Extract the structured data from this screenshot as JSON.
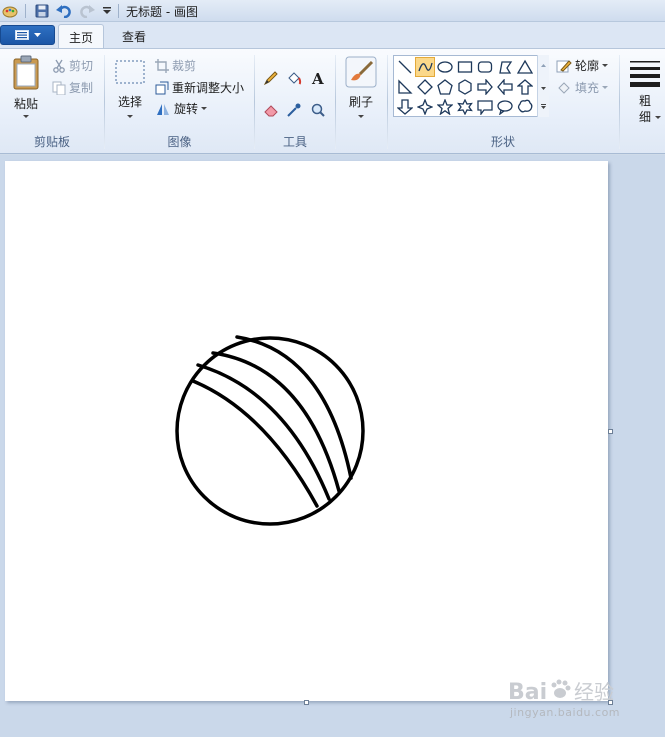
{
  "window": {
    "title": "无标题 - 画图"
  },
  "quick_access": {
    "icons": [
      "paint-app-icon",
      "save-icon",
      "undo-icon",
      "redo-icon",
      "customize-dropdown-icon"
    ]
  },
  "tabs": [
    {
      "label": "主页",
      "active": true
    },
    {
      "label": "查看",
      "active": false
    }
  ],
  "ribbon": {
    "clipboard": {
      "paste": "粘贴",
      "cut": "剪切",
      "copy": "复制",
      "group": "剪贴板"
    },
    "image": {
      "select": "选择",
      "crop": "裁剪",
      "resize": "重新调整大小",
      "rotate": "旋转",
      "group": "图像"
    },
    "tools": {
      "group": "工具",
      "items": [
        "pencil",
        "fill",
        "text",
        "eraser",
        "color-picker",
        "magnifier"
      ]
    },
    "brushes": {
      "label": "刷子"
    },
    "shapes": {
      "outline": "轮廓",
      "fill": "填充",
      "group": "形状",
      "selected": "curve"
    },
    "size": {
      "label_line1": "粗",
      "label_line2": "细"
    }
  },
  "watermark": {
    "brand": "Bai",
    "brand2": "经验",
    "url": "jingyan.baidu.com"
  },
  "colors": {
    "accent": "#1b56a6",
    "selected_tool": "#fbd88a",
    "canvas": "#ffffff"
  }
}
